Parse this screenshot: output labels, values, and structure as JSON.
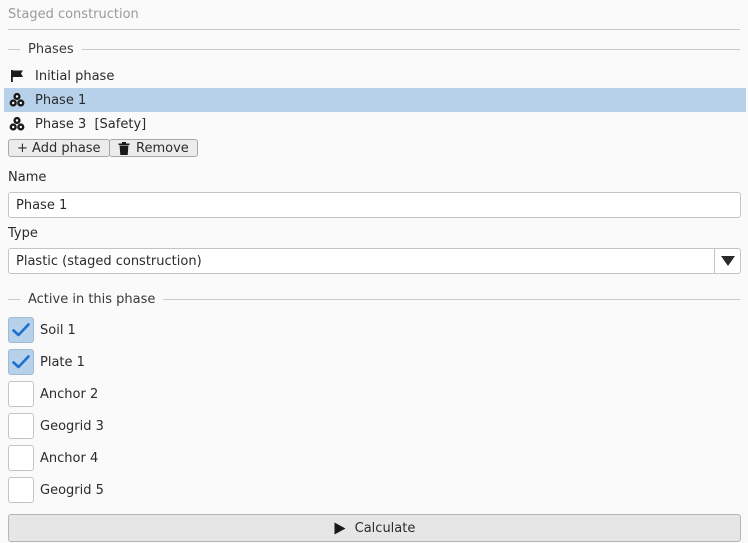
{
  "panel": {
    "title": "Staged construction"
  },
  "phases_group": {
    "label": "Phases",
    "items": [
      {
        "label": "Initial phase",
        "icon": "flag-icon",
        "selected": false
      },
      {
        "label": "Phase 1",
        "icon": "soil-cluster-icon",
        "selected": true
      },
      {
        "label": "Phase 3  [Safety]",
        "icon": "soil-cluster-icon",
        "selected": false
      }
    ],
    "add_button": "+ Add phase",
    "remove_button": "Remove",
    "remove_icon": "trash-icon"
  },
  "name_field": {
    "label": "Name",
    "value": "Phase 1"
  },
  "type_field": {
    "label": "Type",
    "value": "Plastic (staged construction)",
    "icon": "triangle-down-icon"
  },
  "active_group": {
    "label": "Active in this phase",
    "items": [
      {
        "label": "Soil 1",
        "checked": true
      },
      {
        "label": "Plate 1",
        "checked": true
      },
      {
        "label": "Anchor 2",
        "checked": false
      },
      {
        "label": "Geogrid 3",
        "checked": false
      },
      {
        "label": "Anchor 4",
        "checked": false
      },
      {
        "label": "Geogrid 5",
        "checked": false
      }
    ]
  },
  "calculate_button": {
    "label": "Calculate",
    "icon": "play-icon"
  },
  "colors": {
    "selection": "#b7d1ea",
    "check": "#1f6fcf",
    "background": "#fafafa"
  }
}
